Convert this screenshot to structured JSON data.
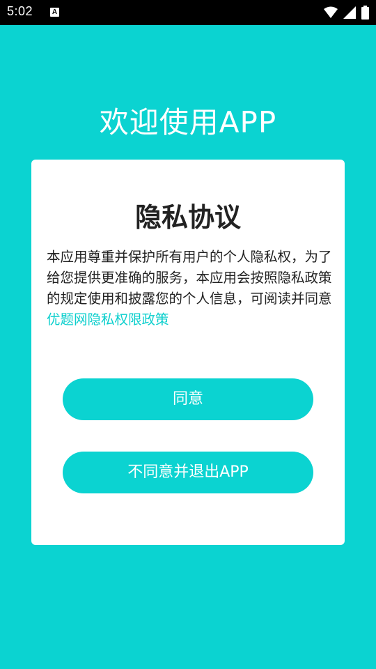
{
  "status_bar": {
    "time": "5:02",
    "notification_icon_letter": "A",
    "icons": [
      "wifi-icon",
      "signal-icon",
      "battery-icon"
    ]
  },
  "colors": {
    "background": "#0bd3d1",
    "card": "#ffffff",
    "link": "#0bcfcd",
    "button": "#0bd3d1"
  },
  "welcome_title": "欢迎使用APP",
  "card": {
    "title": "隐私协议",
    "body_text": "本应用尊重并保护所有用户的个人隐私权，为了给您提供更准确的服务，本应用会按照隐私政策的规定使用和披露您的个人信息，可阅读并同意",
    "policy_link": "优题网隐私权限政策",
    "agree_button": "同意",
    "disagree_button": "不同意并退出APP"
  }
}
